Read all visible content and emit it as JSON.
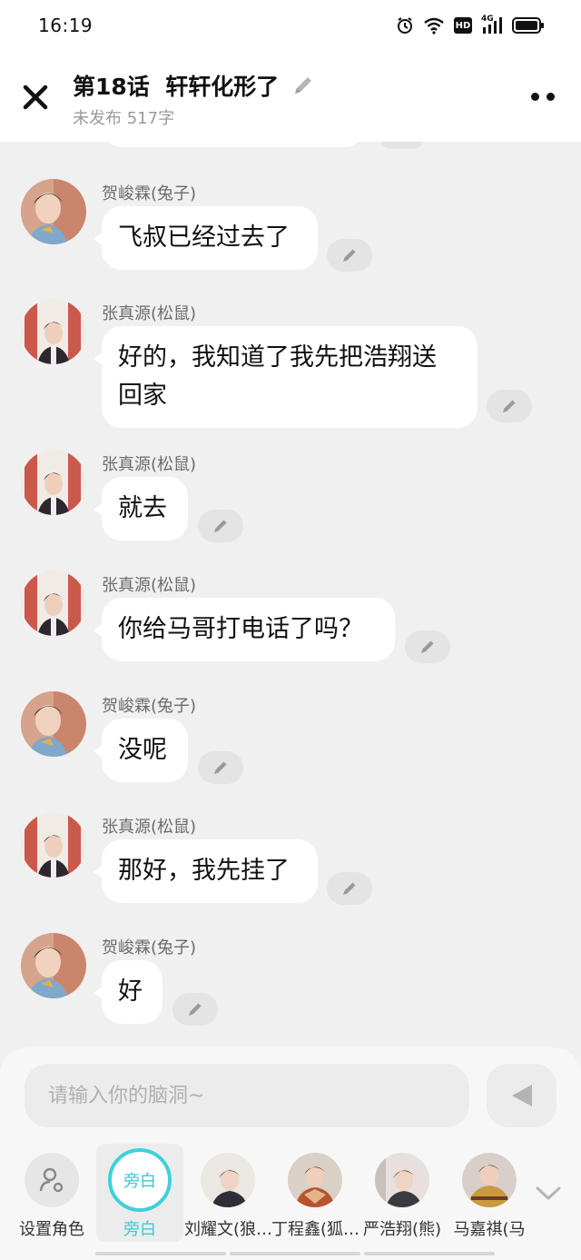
{
  "status_bar": {
    "time": "16:19",
    "hd_label": "HD",
    "network_label": "4G"
  },
  "header": {
    "title": "第18话  轩轩化形了",
    "subtitle": "未发布 517字"
  },
  "messages": [
    {
      "sender": "贺峻霖(兔子)",
      "lines": [
        "飞叔已经过去了"
      ],
      "avatar": "avatar-hejunlin"
    },
    {
      "sender": "张真源(松鼠)",
      "lines": [
        "好的，我知道了我先把浩翔送",
        "回家"
      ],
      "avatar": "avatar-zhangzhenyuan"
    },
    {
      "sender": "张真源(松鼠)",
      "lines": [
        "就去"
      ],
      "avatar": "avatar-zhangzhenyuan"
    },
    {
      "sender": "张真源(松鼠)",
      "lines": [
        "你给马哥打电话了吗？"
      ],
      "avatar": "avatar-zhangzhenyuan"
    },
    {
      "sender": "贺峻霖(兔子)",
      "lines": [
        "没呢"
      ],
      "avatar": "avatar-hejunlin"
    },
    {
      "sender": "张真源(松鼠)",
      "lines": [
        "那好，我先挂了"
      ],
      "avatar": "avatar-zhangzhenyuan"
    },
    {
      "sender": "贺峻霖(兔子)",
      "lines": [
        "好"
      ],
      "avatar": "avatar-hejunlin"
    }
  ],
  "composer": {
    "placeholder": "请输入你的脑洞~"
  },
  "roles": [
    {
      "label": "设置角色",
      "type": "settings"
    },
    {
      "label": "旁白",
      "circle_text": "旁白",
      "type": "narration",
      "selected": true
    },
    {
      "label": "刘耀文(狼…",
      "type": "avatar"
    },
    {
      "label": "丁程鑫(狐…",
      "type": "avatar"
    },
    {
      "label": "严浩翔(熊)",
      "type": "avatar"
    },
    {
      "label": "马嘉祺(马",
      "type": "avatar"
    }
  ],
  "colors": {
    "accent": "#3fd0dc",
    "bubble": "#ffffff",
    "background": "#f0f0f0"
  }
}
